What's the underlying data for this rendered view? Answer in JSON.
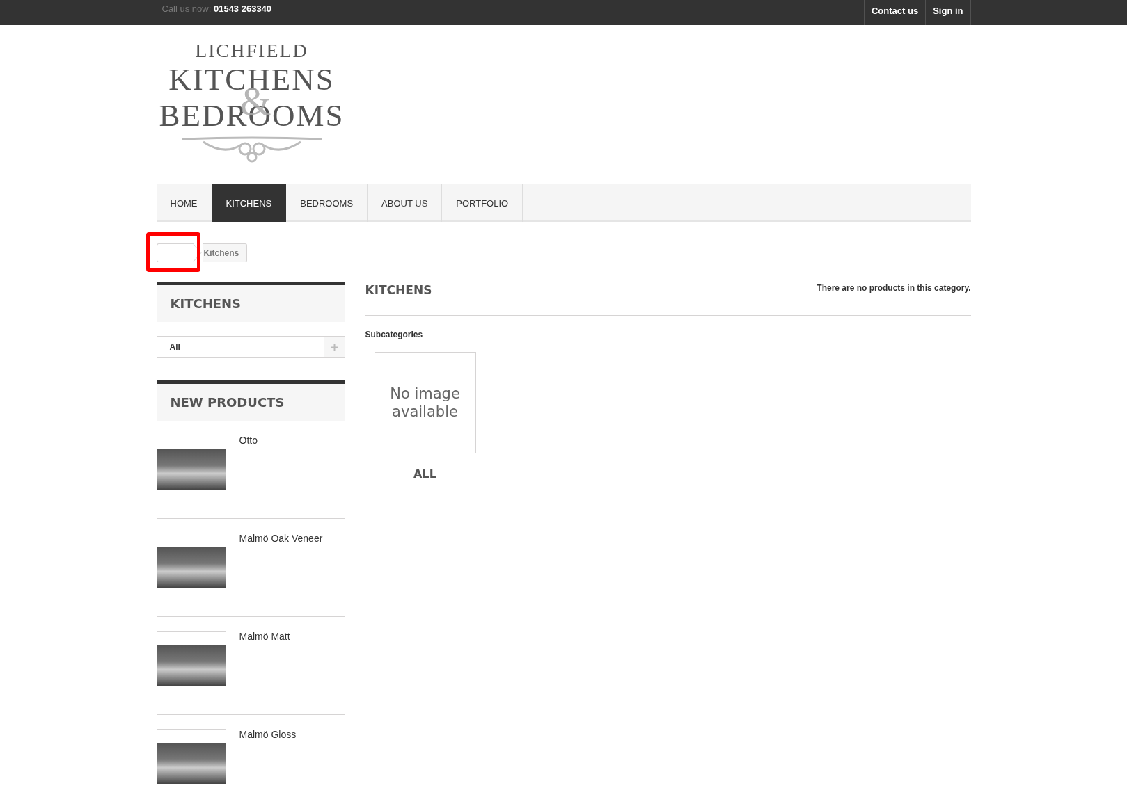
{
  "top_bar": {
    "call_label": "Call us now:",
    "phone": "01543 263340",
    "links": [
      "Contact us",
      "Sign in"
    ]
  },
  "logo": {
    "line_1": "LICHFIELD",
    "line_2": "KITCHENS",
    "ampersand": "&",
    "line_3": "BEDROOMS"
  },
  "nav": [
    {
      "label": "HOME",
      "selected": false
    },
    {
      "label": "KITCHENS",
      "selected": true
    },
    {
      "label": "BEDROOMS",
      "selected": false
    },
    {
      "label": "ABOUT US",
      "selected": false
    },
    {
      "label": "PORTFOLIO",
      "selected": false
    }
  ],
  "breadcrumb": {
    "current": "Kitchens",
    "home_highlighted": true
  },
  "sidebar": {
    "categories": {
      "title": "KITCHENS",
      "items": [
        {
          "label": "All",
          "expanded": false
        }
      ]
    },
    "new_products": {
      "title": "NEW PRODUCTS",
      "items": [
        {
          "name": "Otto"
        },
        {
          "name": "Malmö Oak Veneer"
        },
        {
          "name": "Malmö Matt"
        },
        {
          "name": "Malmö Gloss"
        }
      ]
    }
  },
  "main": {
    "title": "KITCHENS",
    "notice": "There are no products in this category.",
    "subcategories_heading": "Subcategories",
    "subcategories": [
      {
        "image_text": "No image available",
        "name": "ALL"
      }
    ]
  }
}
